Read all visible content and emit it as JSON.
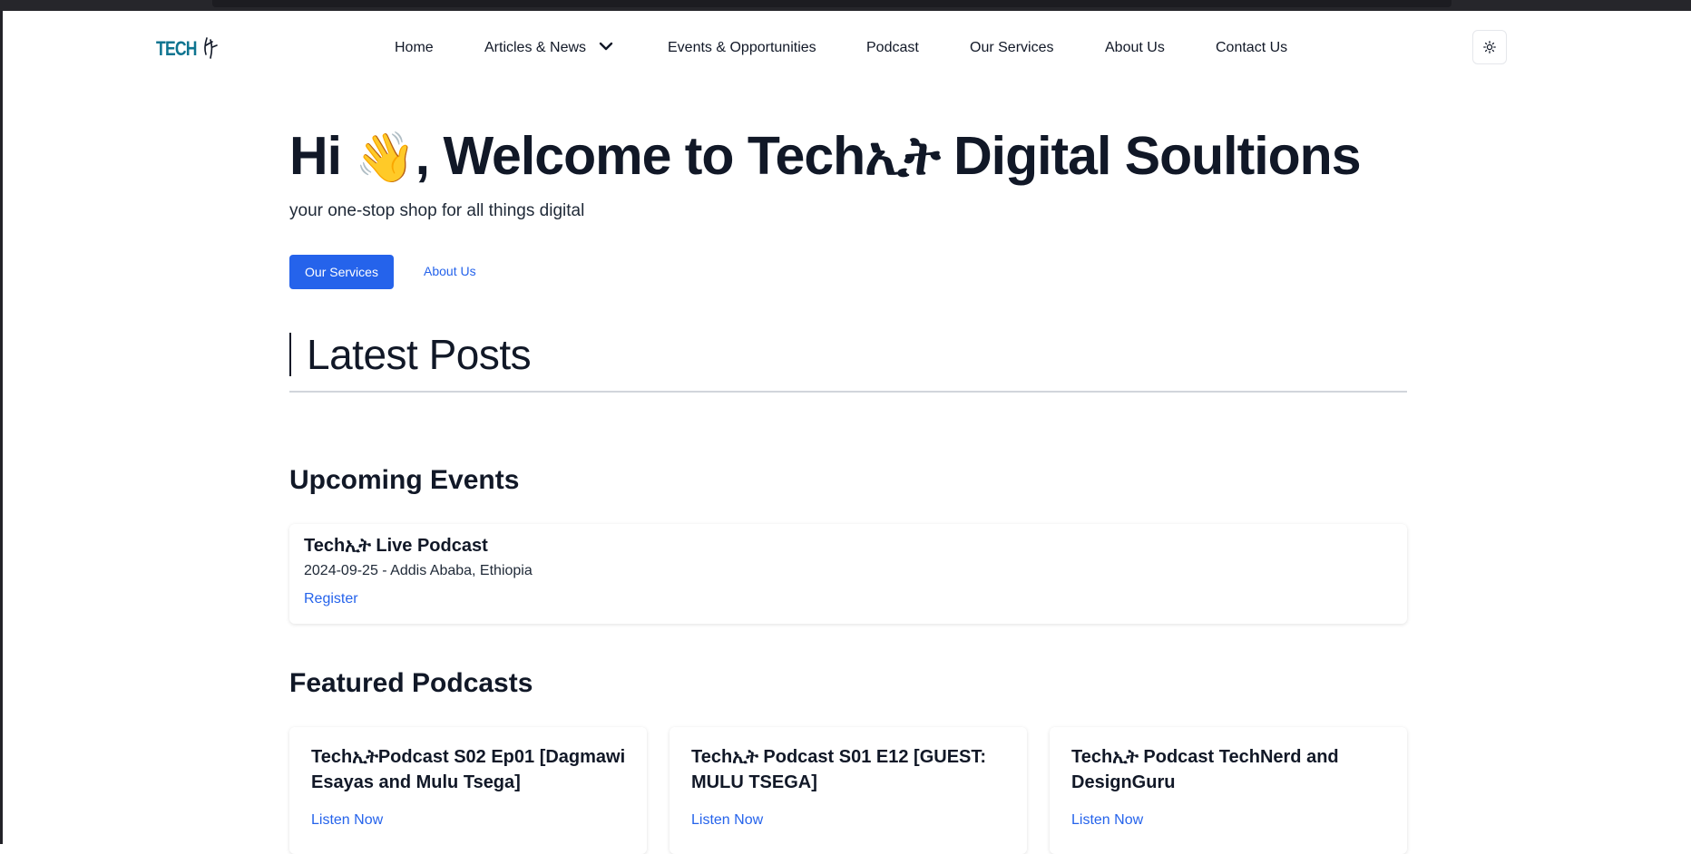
{
  "brand": {
    "logo_text": "TECH"
  },
  "nav": {
    "items": [
      "Home",
      "Articles & News",
      "Events & Opportunities",
      "Podcast",
      "Our Services",
      "About Us",
      "Contact Us"
    ]
  },
  "hero": {
    "title_prefix": "Hi ",
    "wave_emoji": "👋",
    "title_suffix": ", Welcome to Techኢት Digital Soultions",
    "subtitle": "your one-stop shop for all things digital",
    "primary_button": "Our Services",
    "secondary_button": "About Us"
  },
  "latest_posts": {
    "heading": "Latest Posts"
  },
  "events": {
    "heading": "Upcoming Events",
    "items": [
      {
        "title": "Techኢት Live Podcast",
        "meta": "2024-09-25 - Addis Ababa, Ethiopia",
        "link": "Register"
      }
    ]
  },
  "podcasts": {
    "heading": "Featured Podcasts",
    "items": [
      {
        "title": "TechኢትPodcast S02 Ep01 [Dagmawi Esayas and Mulu Tsega]",
        "link": "Listen Now"
      },
      {
        "title": "Techኢት Podcast S01 E12 [GUEST: MULU TSEGA]",
        "link": "Listen Now"
      },
      {
        "title": "Techኢት Podcast TechNerd and DesignGuru",
        "link": "Listen Now"
      }
    ]
  },
  "colors": {
    "accent": "#2563eb",
    "logo": "#0e7490",
    "text": "#111827"
  },
  "icons": {
    "theme_toggle": "sun-icon",
    "dropdown": "chevron-down-icon"
  }
}
